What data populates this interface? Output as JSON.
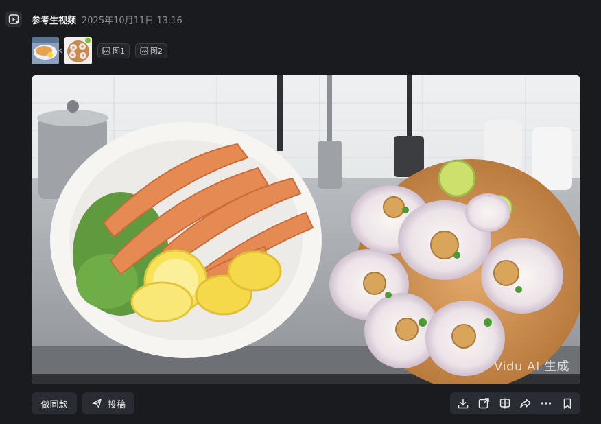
{
  "header": {
    "title": "参考生视频",
    "date": "2025年10月11日 13:16",
    "icon": "video-reference-icon"
  },
  "references": {
    "chips": [
      {
        "label": "图1",
        "icon": "image-ref-icon"
      },
      {
        "label": "图2",
        "icon": "image-ref-icon"
      }
    ]
  },
  "media": {
    "watermark": "Vidu AI 生成"
  },
  "footer": {
    "same_label": "做同款",
    "post_label": "投稿",
    "tools": [
      "download-icon",
      "expand-icon",
      "split-icon",
      "share-icon",
      "more-icon",
      "bookmark-icon"
    ]
  },
  "colors": {
    "background": "#1a1b1e",
    "button": "#2a2c33",
    "text": "#e9e9ea",
    "muted": "#8b8e96"
  }
}
